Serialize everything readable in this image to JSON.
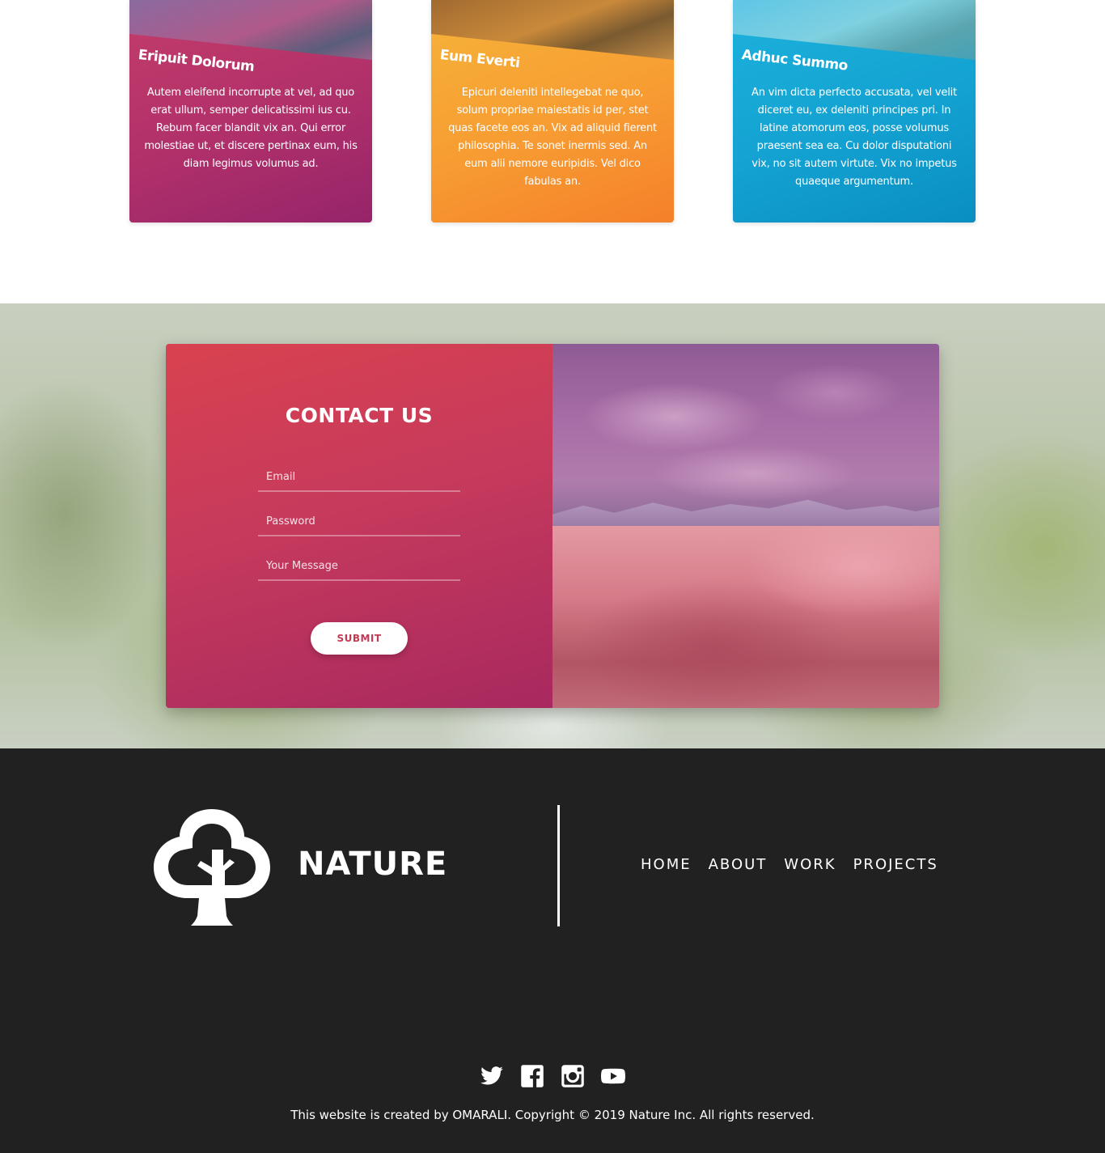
{
  "cards": [
    {
      "title": "Eripuit Dolorum",
      "text": "Autem eleifend incorrupte at vel, ad quo erat ullum, semper delicatissimi ius cu. Rebum facer blandit vix an. Qui error molestiae ut, et discere pertinax eum, his diam legimus volumus ad.",
      "color": "#b0306a"
    },
    {
      "title": "Eum Everti",
      "text": "Epicuri deleniti intellegebat ne quo, solum propriae maiestatis id per, stet quas facete eos an. Vix ad aliquid fierent philosophia. Te sonet inermis sed. An eum alii nemore euripidis. Vel dico fabulas an.",
      "color": "#f79c32"
    },
    {
      "title": "Adhuc Summo",
      "text": "An vim dicta perfecto accusata, vel velit diceret eu, ex deleniti principes pri. In latine atomorum eos, posse volumus praesent sea ea. Cu dolor disputationi vix, no sit autem virtute. Vix no impetus quaeque argumentum.",
      "color": "#13a2d2"
    }
  ],
  "contact": {
    "title": "CONTACT US",
    "email_placeholder": "Email",
    "password_placeholder": "Password",
    "message_placeholder": "Your Message",
    "submit_label": "SUBMIT"
  },
  "footer": {
    "brand": "NATURE",
    "nav": [
      "HOME",
      "ABOUT",
      "WORK",
      "PROJECTS"
    ],
    "socials": [
      "twitter-icon",
      "facebook-icon",
      "instagram-icon",
      "youtube-icon"
    ],
    "copyright": "This website is created by OMARALI. Copyright © 2019 Nature Inc. All rights reserved."
  }
}
